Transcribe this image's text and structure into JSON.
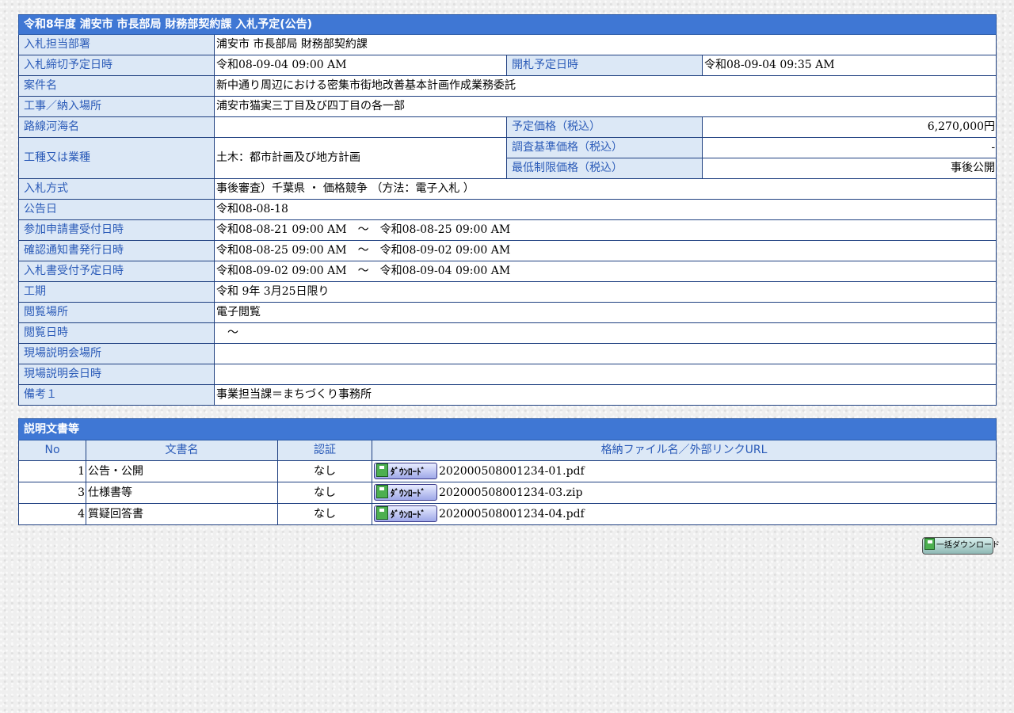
{
  "info": {
    "title": "令和8年度 浦安市 市長部局 財務部契約課 入札予定(公告)",
    "dept_label": "入札担当部署",
    "dept_value": "浦安市 市長部局 財務部契約課",
    "deadline_label": "入札締切予定日時",
    "deadline_value": "令和08-09-04 09:00 AM",
    "opening_label": "開札予定日時",
    "opening_value": "令和08-09-04 09:35 AM",
    "case_label": "案件名",
    "case_value": "新中通り周辺における密集市街地改善基本計画作成業務委託",
    "place_label": "工事／納入場所",
    "place_value": "浦安市猫実三丁目及び四丁目の各一部",
    "route_label": "路線河海名",
    "route_value": "",
    "budget_label": "予定価格（税込）",
    "budget_value": "6,270,000円",
    "type_label": "工種又は業種",
    "type_value": "土木：都市計画及び地方計画",
    "survey_label": "調査基準価格（税込）",
    "survey_value": "-",
    "min_label": "最低制限価格（税込）",
    "min_value": "事後公開",
    "method_label": "入札方式",
    "method_value": "事後審査）千葉県 ・ 価格競争 （方法：電子入札 ）",
    "notice_label": "公告日",
    "notice_value": "令和08-08-18",
    "apply_label": "参加申請書受付日時",
    "apply_value": "令和08-08-21 09:00 AM　～　令和08-08-25 09:00 AM",
    "confirm_label": "確認通知書発行日時",
    "confirm_value": "令和08-08-25 09:00 AM　～　令和08-09-02 09:00 AM",
    "bidrecv_label": "入札書受付予定日時",
    "bidrecv_value": "令和08-09-02 09:00 AM　～　令和08-09-04 09:00 AM",
    "period_label": "工期",
    "period_value": "令和 9年 3月25日限り",
    "viewplace_label": "閲覧場所",
    "viewplace_value": "電子閲覧",
    "viewdate_label": "閲覧日時",
    "viewdate_value": "　～",
    "siteplace_label": "現場説明会場所",
    "siteplace_value": "",
    "sitedate_label": "現場説明会日時",
    "sitedate_value": "",
    "note_label": "備考１",
    "note_value": "事業担当課＝まちづくり事務所"
  },
  "docs": {
    "title": "説明文書等",
    "headers": [
      "No",
      "文書名",
      "認証",
      "格納ファイル名／外部リンクURL"
    ],
    "button_label": "ﾀﾞｳﾝﾛｰﾄﾞ",
    "rows": [
      {
        "no": "1",
        "name": "公告・公開",
        "auth": "なし",
        "file": "202000508001234-01.pdf"
      },
      {
        "no": "3",
        "name": "仕様書等",
        "auth": "なし",
        "file": "202000508001234-03.zip"
      },
      {
        "no": "4",
        "name": "質疑回答書",
        "auth": "なし",
        "file": "202000508001234-04.pdf"
      }
    ]
  },
  "bulk_download_label": "一括ダウンロード",
  "icons": {
    "download": "floppy-disk-icon"
  },
  "colors": {
    "header_bg": "#3f77d4",
    "label_bg": "#dce8f6",
    "label_text": "#2b5bb8",
    "border": "#1e3f80"
  }
}
